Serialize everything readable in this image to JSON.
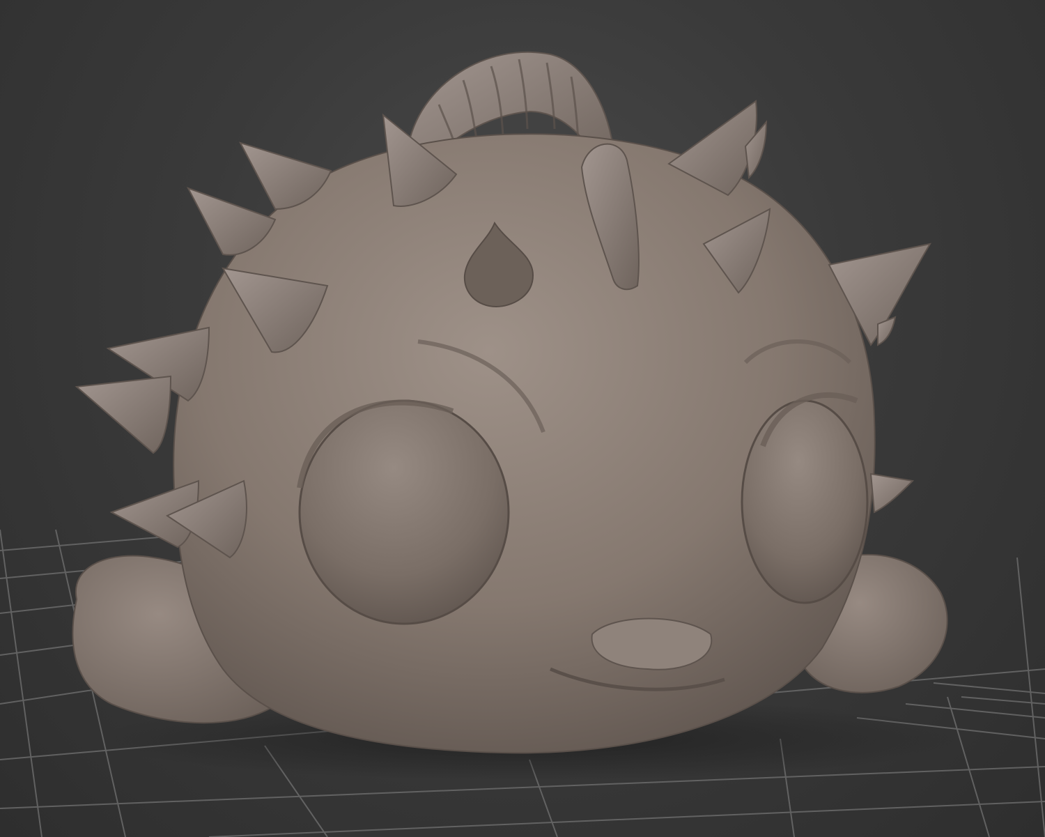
{
  "viewport": {
    "background_color": "#3a3a3a",
    "model_color": "#877a70",
    "grid_color": "#6e6e6e"
  },
  "model": {
    "icon": "creature-sculpt-model"
  },
  "floor": {
    "icon": "floor-grid"
  }
}
